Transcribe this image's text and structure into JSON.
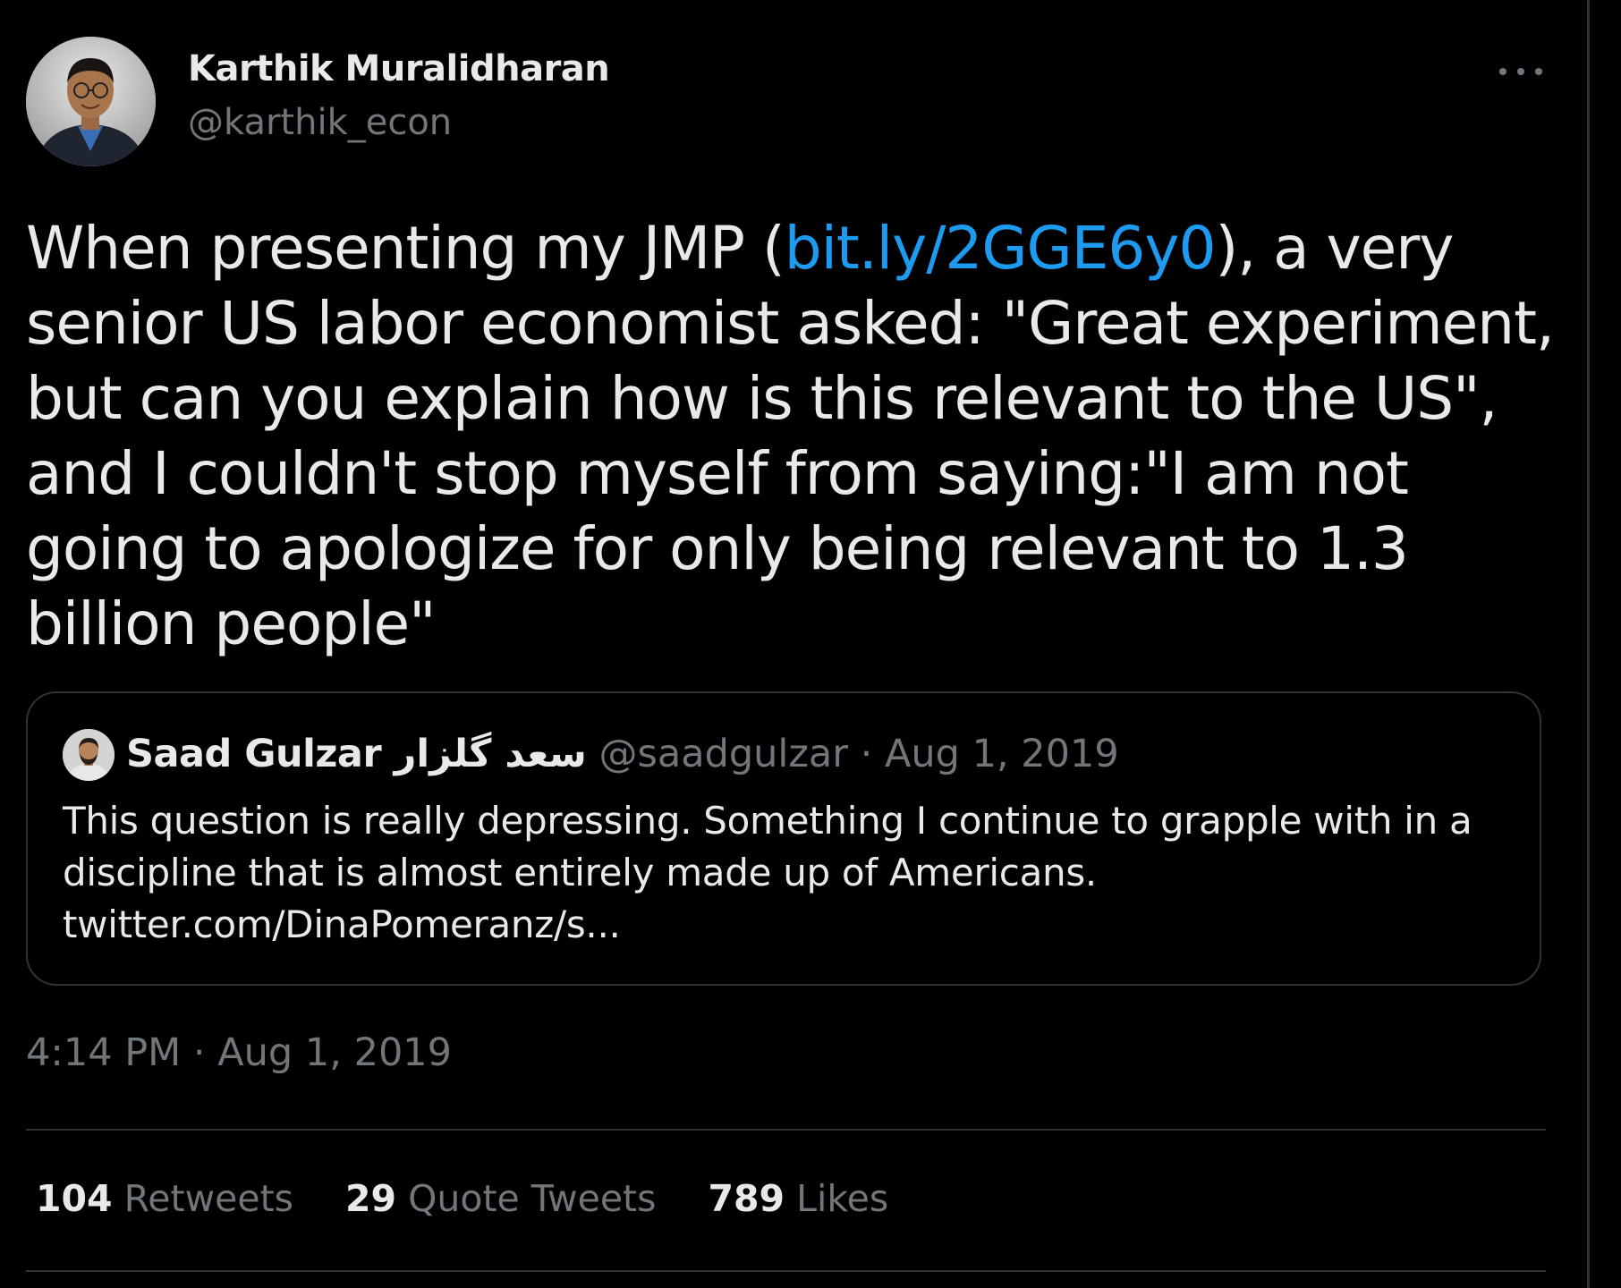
{
  "author": {
    "display_name": "Karthik Muralidharan",
    "handle": "@karthik_econ"
  },
  "tweet": {
    "text_before_link": "When presenting my JMP (",
    "link": "bit.ly/2GGE6y0",
    "text_after_link": "), a very senior US labor economist asked: \"Great experiment, but can you explain how is this relevant to the US\", and I couldn't stop myself from saying:\"I am not going to apologize for only being relevant to 1.3 billion people\"",
    "timestamp": "4:14 PM · Aug 1, 2019"
  },
  "quoted_tweet": {
    "display_name": "Saad Gulzar سعد گلزار",
    "handle": "@saadgulzar",
    "separator": "·",
    "date": "Aug 1, 2019",
    "text_lines": [
      "This question is really depressing. Something I continue to grapple with in a",
      "discipline that is almost entirely made up of Americans.",
      "twitter.com/DinaPomeranz/s..."
    ]
  },
  "stats": [
    {
      "count": "104",
      "label": "Retweets"
    },
    {
      "count": "29",
      "label": "Quote Tweets"
    },
    {
      "count": "789",
      "label": "Likes"
    }
  ],
  "icons": {
    "more": "more-horizontal-icon"
  },
  "colors": {
    "background": "#000000",
    "text": "#e7e9ea",
    "secondary": "#71767b",
    "link": "#1d9bf0",
    "border": "#2f3336"
  }
}
